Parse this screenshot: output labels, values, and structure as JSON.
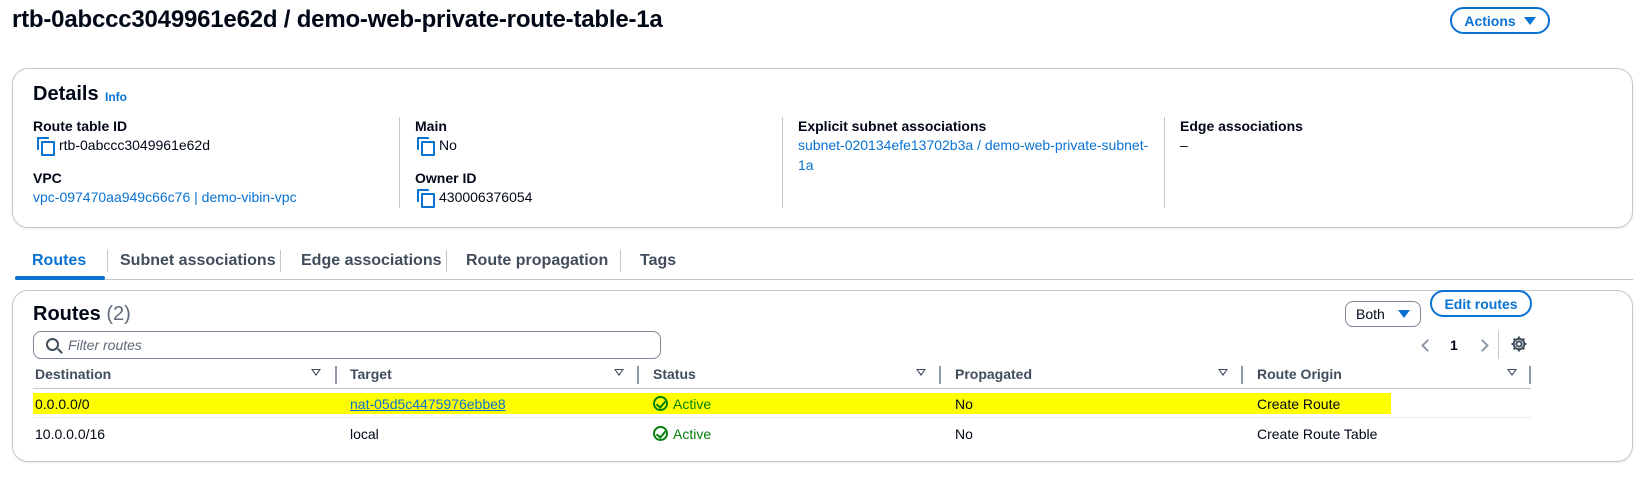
{
  "header": {
    "title": "rtb-0abccc3049961e62d / demo-web-private-route-table-1a",
    "actions_label": "Actions"
  },
  "details": {
    "heading": "Details",
    "info_label": "Info",
    "route_table_id_label": "Route table ID",
    "route_table_id": "rtb-0abccc3049961e62d",
    "vpc_label": "VPC",
    "vpc_value": "vpc-097470aa949c66c76 | demo-vibin-vpc",
    "main_label": "Main",
    "main_value": "No",
    "owner_id_label": "Owner ID",
    "owner_id": "430006376054",
    "explicit_subnet_label": "Explicit subnet associations",
    "explicit_subnet_line1": "subnet-020134efe13702b3a / demo-web-private-subnet-",
    "explicit_subnet_line2": "1a",
    "edge_label": "Edge associations",
    "edge_value": "–"
  },
  "tabs": [
    {
      "label": "Routes",
      "active": true
    },
    {
      "label": "Subnet associations",
      "active": false
    },
    {
      "label": "Edge associations",
      "active": false
    },
    {
      "label": "Route propagation",
      "active": false
    },
    {
      "label": "Tags",
      "active": false
    }
  ],
  "routes": {
    "heading": "Routes",
    "count": "(2)",
    "filter_placeholder": "Filter routes",
    "select_value": "Both",
    "edit_label": "Edit routes",
    "page_number": "1",
    "columns": [
      "Destination",
      "Target",
      "Status",
      "Propagated",
      "Route Origin"
    ],
    "rows": [
      {
        "destination": "0.0.0.0/0",
        "target": "nat-05d5c4475976ebbe8",
        "target_is_link": true,
        "status": "Active",
        "propagated": "No",
        "origin": "Create Route",
        "highlighted": true
      },
      {
        "destination": "10.0.0.0/16",
        "target": "local",
        "target_is_link": false,
        "status": "Active",
        "propagated": "No",
        "origin": "Create Route Table",
        "highlighted": false
      }
    ]
  },
  "colors": {
    "accent": "#0972d3",
    "success": "#037f0c",
    "highlight": "#ffff00"
  }
}
